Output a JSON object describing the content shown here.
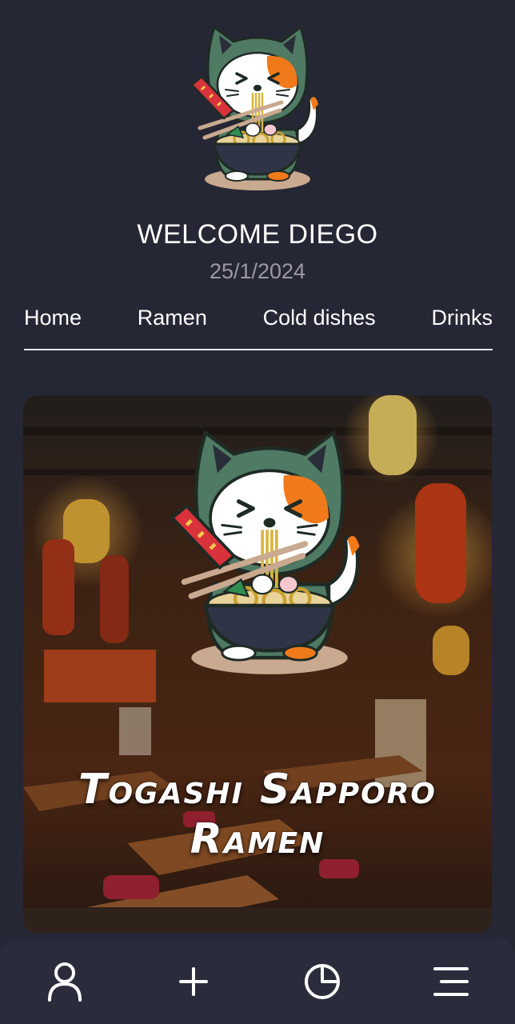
{
  "header": {
    "welcome": "WELCOME DIEGO",
    "date": "25/1/2024"
  },
  "tabs": [
    {
      "label": "Home"
    },
    {
      "label": "Ramen"
    },
    {
      "label": "Cold dishes"
    },
    {
      "label": "Drinks"
    }
  ],
  "hero": {
    "title_line1": "Togashi Sapporo",
    "title_line2": "Ramen"
  },
  "bottom_nav": [
    {
      "icon": "user-icon"
    },
    {
      "icon": "plus-icon"
    },
    {
      "icon": "pie-chart-icon"
    },
    {
      "icon": "menu-icon"
    }
  ],
  "colors": {
    "background": "#262735",
    "nav_background": "#2b2c3b",
    "cat_hood": "#4f7a63",
    "cat_orange": "#f07a1a",
    "date_text": "#9a9aa5"
  }
}
